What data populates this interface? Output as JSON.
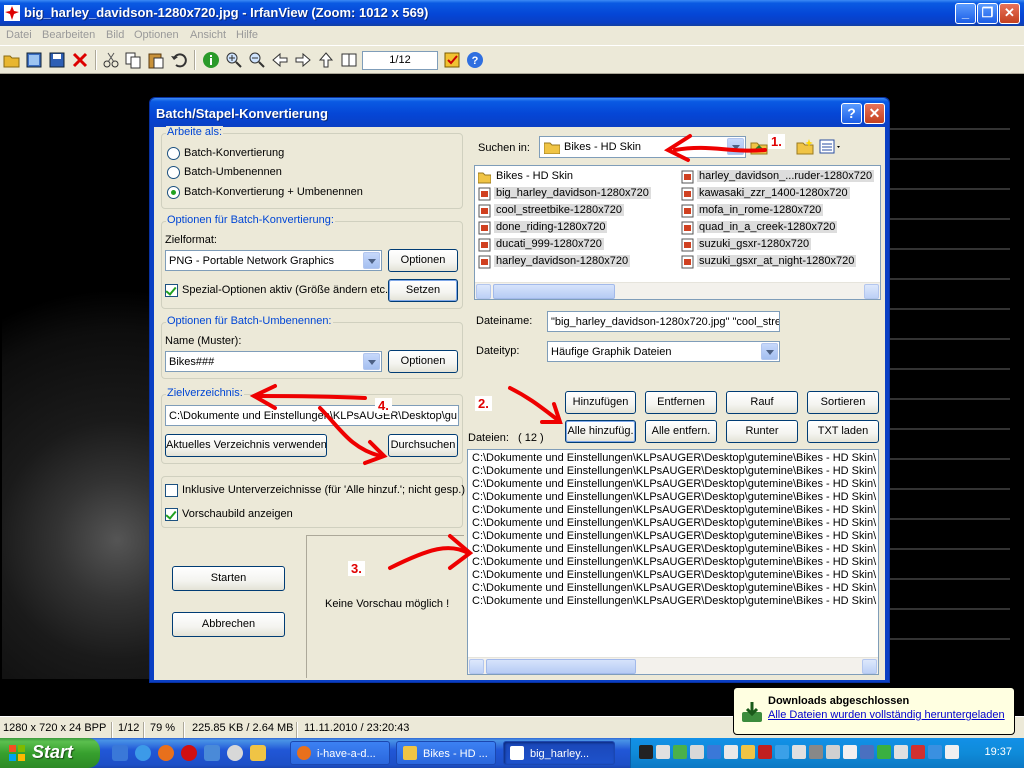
{
  "window": {
    "title": "big_harley_davidson-1280x720.jpg - IrfanView (Zoom: 1012 x 569)",
    "minimize_label": "_",
    "restore_label": "❐",
    "close_label": "✕"
  },
  "menu": [
    "Datei",
    "Bearbeiten",
    "Bild",
    "Optionen",
    "Ansicht",
    "Hilfe"
  ],
  "toolbar": {
    "page_counter": "1/12",
    "icons": [
      "open-icon",
      "thumbnails-icon",
      "save-icon",
      "delete-icon",
      "cut-icon",
      "copy-icon",
      "paste-icon",
      "undo-icon",
      "info-icon",
      "zoom-in-icon",
      "zoom-out-icon",
      "previous-icon",
      "next-icon",
      "first-icon",
      "slideshow-icon",
      "properties-icon",
      "help-icon"
    ]
  },
  "dialog": {
    "title": "Batch/Stapel-Konvertierung",
    "help_label": "?",
    "close_label": "✕",
    "work_as": {
      "group_label": "Arbeite als:",
      "options": [
        "Batch-Konvertierung",
        "Batch-Umbenennen",
        "Batch-Konvertierung + Umbenennen"
      ],
      "selected_index": 2
    },
    "convert_options": {
      "group_label": "Optionen für Batch-Konvertierung:",
      "format_label": "Zielformat:",
      "format_value": "PNG - Portable Network Graphics",
      "options_button": "Optionen",
      "special_checkbox": "Spezial-Optionen aktiv (Größe ändern etc.)",
      "special_checked": true,
      "set_button": "Setzen"
    },
    "rename_options": {
      "group_label": "Optionen für Batch-Umbenennen:",
      "name_label": "Name (Muster):",
      "name_value": "Bikes###",
      "options_button": "Optionen"
    },
    "target_dir": {
      "group_label": "Zielverzeichnis:",
      "path": "C:\\Dokumente und Einstellungen\\KLPsAUGER\\Desktop\\gu",
      "use_current_button": "Aktuelles Verzeichnis verwenden",
      "browse_button": "Durchsuchen"
    },
    "subdirs_checkbox": "Inklusive Unterverzeichnisse (für 'Alle hinzuf.'; nicht gesp.)",
    "subdirs_checked": false,
    "preview_checkbox": "Vorschaubild anzeigen",
    "preview_checked": true,
    "start_button": "Starten",
    "cancel_button": "Abbrechen",
    "no_preview_text": "Keine Vorschau möglich !",
    "browser": {
      "search_label": "Suchen in:",
      "search_value": "Bikes - HD Skin",
      "files_col1": [
        "Bikes - HD Skin",
        "big_harley_davidson-1280x720",
        "cool_streetbike-1280x720",
        "done_riding-1280x720",
        "ducati_999-1280x720",
        "harley_davidson-1280x720"
      ],
      "files_col2": [
        "harley_davidson_...ruder-1280x720",
        "kawasaki_zzr_1400-1280x720",
        "mofa_in_rome-1280x720",
        "quad_in_a_creek-1280x720",
        "suzuki_gsxr-1280x720",
        "suzuki_gsxr_at_night-1280x720"
      ],
      "filename_label": "Dateiname:",
      "filename_value": "\"big_harley_davidson-1280x720.jpg\" \"cool_stre",
      "filetype_label": "Dateityp:",
      "filetype_value": "Häufige Graphik Dateien"
    },
    "list_buttons": {
      "add": "Hinzufügen",
      "remove": "Entfernen",
      "up": "Rauf",
      "sort": "Sortieren",
      "add_all": "Alle hinzufüg.",
      "remove_all": "Alle entfern.",
      "down": "Runter",
      "load_txt": "TXT laden"
    },
    "files_label": "Dateien:",
    "files_count": "( 12 )",
    "file_list": [
      "C:\\Dokumente und Einstellungen\\KLPsAUGER\\Desktop\\gutemine\\Bikes - HD Skin\\",
      "C:\\Dokumente und Einstellungen\\KLPsAUGER\\Desktop\\gutemine\\Bikes - HD Skin\\",
      "C:\\Dokumente und Einstellungen\\KLPsAUGER\\Desktop\\gutemine\\Bikes - HD Skin\\",
      "C:\\Dokumente und Einstellungen\\KLPsAUGER\\Desktop\\gutemine\\Bikes - HD Skin\\",
      "C:\\Dokumente und Einstellungen\\KLPsAUGER\\Desktop\\gutemine\\Bikes - HD Skin\\",
      "C:\\Dokumente und Einstellungen\\KLPsAUGER\\Desktop\\gutemine\\Bikes - HD Skin\\",
      "C:\\Dokumente und Einstellungen\\KLPsAUGER\\Desktop\\gutemine\\Bikes - HD Skin\\",
      "C:\\Dokumente und Einstellungen\\KLPsAUGER\\Desktop\\gutemine\\Bikes - HD Skin\\",
      "C:\\Dokumente und Einstellungen\\KLPsAUGER\\Desktop\\gutemine\\Bikes - HD Skin\\",
      "C:\\Dokumente und Einstellungen\\KLPsAUGER\\Desktop\\gutemine\\Bikes - HD Skin\\",
      "C:\\Dokumente und Einstellungen\\KLPsAUGER\\Desktop\\gutemine\\Bikes - HD Skin\\",
      "C:\\Dokumente und Einstellungen\\KLPsAUGER\\Desktop\\gutemine\\Bikes - HD Skin\\"
    ]
  },
  "annotations": {
    "step1": "1.",
    "step2": "2.",
    "step3": "3.",
    "step4": "4."
  },
  "statusbar": {
    "dimensions": "1280 x 720 x 24 BPP",
    "index": "1/12",
    "zoom": "79 %",
    "size": "225.85 KB / 2.64 MB",
    "datetime": "11.11.2010 / 23:20:43"
  },
  "balloon": {
    "title": "Downloads abgeschlossen",
    "text": "Alle Dateien wurden vollständig heruntergeladen"
  },
  "taskbar": {
    "start_label": "Start",
    "tasks": [
      "i-have-a-d...",
      "Bikes - HD ...",
      "big_harley..."
    ],
    "active_task_index": 2,
    "clock": "19:37"
  },
  "colors": {
    "xp_blue": "#0a5ae3",
    "dialog_face": "#ece9d8",
    "group_label": "#0046d5",
    "annotation_red": "#e00000"
  }
}
